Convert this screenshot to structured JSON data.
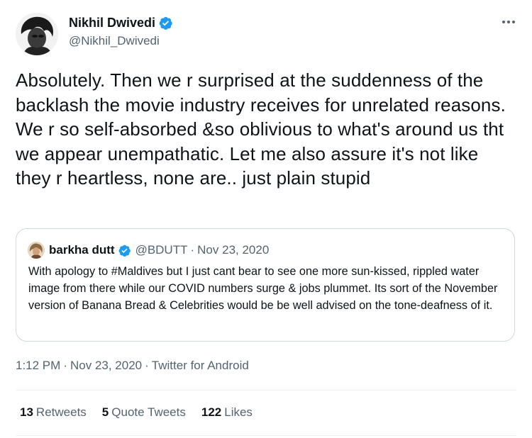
{
  "author": {
    "name": "Nikhil Dwivedi",
    "handle": "@Nikhil_Dwivedi",
    "verified": true
  },
  "tweet_text": "Absolutely. Then we r surprised at the suddenness of the backlash the movie industry receives for unrelated reasons. We r so self-absorbed &so oblivious to what's around us tht we appear unempathatic. Let me also assure it's not like they r heartless, none are.. just plain stupid",
  "quoted": {
    "name": "barkha dutt",
    "handle": "@BDUTT",
    "separator": "·",
    "date": "Nov 23, 2020",
    "verified": true,
    "text": "With apology to #Maldives but I just cant bear to see one more sun-kissed, rippled water image from there while our COVID numbers surge & jobs plummet. Its sort of the November version of Banana Bread & Celebrities would be be well advised on the tone-deafness of it."
  },
  "meta": {
    "time": "1:12 PM",
    "separator": "·",
    "date": "Nov 23, 2020",
    "source": "Twitter for Android"
  },
  "stats": {
    "retweets_count": "13",
    "retweets_label": "Retweets",
    "quotes_count": "5",
    "quotes_label": "Quote Tweets",
    "likes_count": "122",
    "likes_label": "Likes"
  },
  "colors": {
    "verified_blue": "#1d9bf0",
    "secondary_text": "#536471",
    "border": "#cfd9de"
  },
  "icons": {
    "verified": "verified-badge-icon",
    "more": "more-options-icon"
  }
}
